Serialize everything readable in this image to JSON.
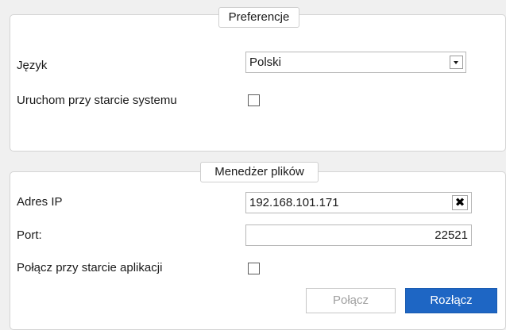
{
  "preferences": {
    "title": "Preferencje",
    "language_label": "Język",
    "language_value": "Polski",
    "autostart_label": "Uruchom przy starcie systemu",
    "autostart_checked": false
  },
  "file_manager": {
    "title": "Menedżer plików",
    "ip_label": "Adres IP",
    "ip_value": "192.168.101.171",
    "port_label": "Port:",
    "port_value": "22521",
    "autoconnect_label": "Połącz przy starcie aplikacji",
    "autoconnect_checked": false,
    "connect_label": "Połącz",
    "connect_enabled": false,
    "disconnect_label": "Rozłącz",
    "disconnect_enabled": true
  },
  "icons": {
    "dropdown": "chevron-down-icon",
    "clear": "close-icon"
  },
  "colors": {
    "primary_button": "#1e66c4",
    "disabled_text": "#a0a0a0"
  }
}
